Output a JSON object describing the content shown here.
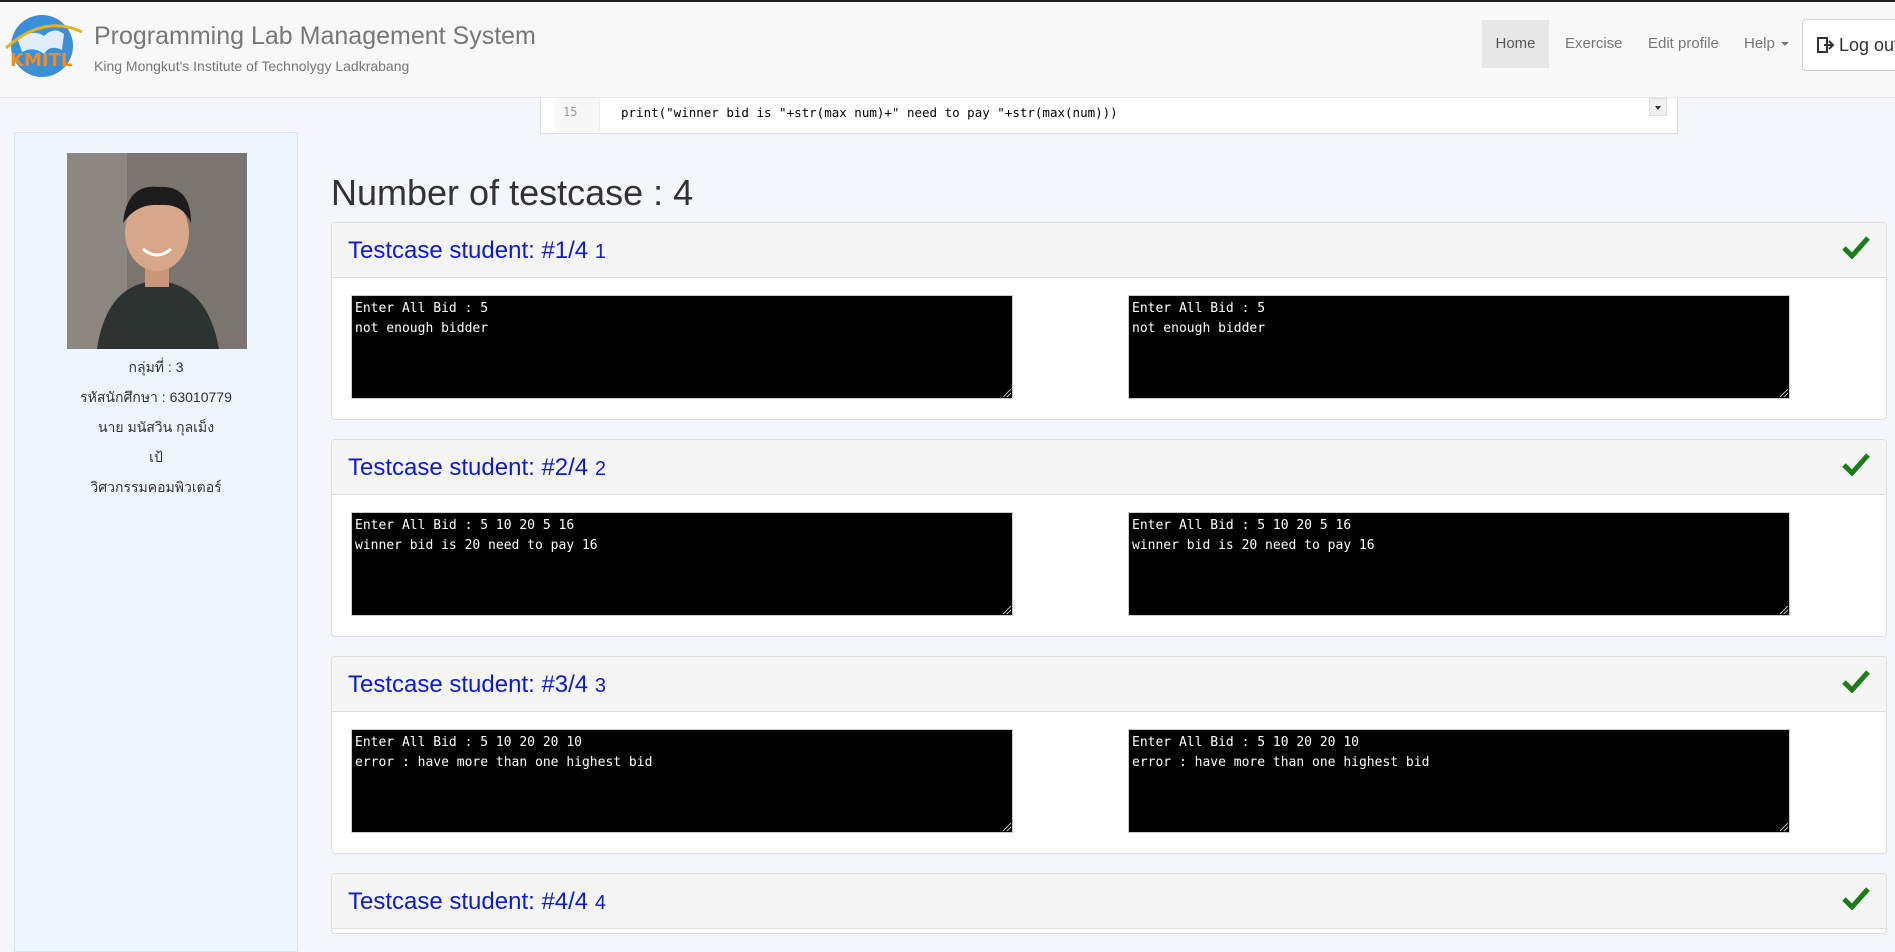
{
  "app": {
    "title": "Programming Lab Management System",
    "subtitle": "King Mongkut's Institute of Technolygy Ladkrabang",
    "logo_text": "KMITL"
  },
  "nav": {
    "home": "Home",
    "exercise": "Exercise",
    "edit_profile": "Edit profile",
    "help": "Help",
    "logout": "Log out"
  },
  "code_preview": {
    "line_number": "15",
    "line_text": "print(\"winner bid is \"+str(max num)+\" need to pay \"+str(max(num)))"
  },
  "student": {
    "group": "กลุ่มที่ : 3",
    "student_id": "รหัสนักศึกษา : 63010779",
    "name": "นาย มนัสวิน กุลเม็ง",
    "nickname": "เป้",
    "department": "วิศวกรรมคอมพิวเตอร์"
  },
  "testcase_header": "Number of testcase : 4",
  "testcases": [
    {
      "title": "Testcase student: #1/4",
      "num": "1",
      "status_icon": "check-icon",
      "student_output": "Enter All Bid : 5\nnot enough bidder",
      "expected_output": "Enter All Bid : 5\nnot enough bidder"
    },
    {
      "title": "Testcase student: #2/4",
      "num": "2",
      "status_icon": "check-icon",
      "student_output": "Enter All Bid : 5 10 20 5 16\nwinner bid is 20 need to pay 16",
      "expected_output": "Enter All Bid : 5 10 20 5 16\nwinner bid is 20 need to pay 16"
    },
    {
      "title": "Testcase student: #3/4",
      "num": "3",
      "status_icon": "check-icon",
      "student_output": "Enter All Bid : 5 10 20 20 10\nerror : have more than one highest bid",
      "expected_output": "Enter All Bid : 5 10 20 20 10\nerror : have more than one highest bid"
    },
    {
      "title": "Testcase student: #4/4",
      "num": "4",
      "status_icon": "check-icon"
    }
  ],
  "colors": {
    "title_blue": "#0b18e8",
    "check_green": "#1a7d1a",
    "terminal_bg": "#000000"
  }
}
